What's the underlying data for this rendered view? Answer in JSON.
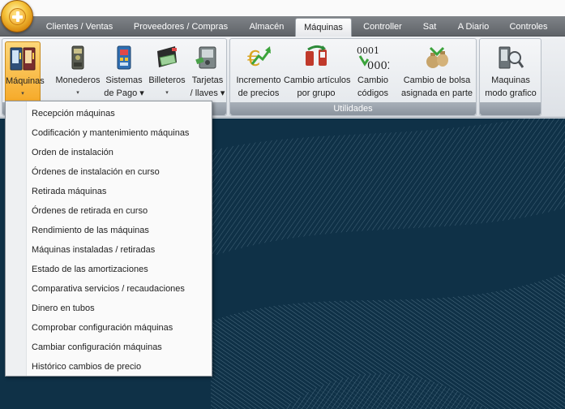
{
  "tabs": [
    {
      "label": "Clientes / Ventas"
    },
    {
      "label": "Proveedores / Compras"
    },
    {
      "label": "Almacén"
    },
    {
      "label": "Máquinas"
    },
    {
      "label": "Controller"
    },
    {
      "label": "Sat"
    },
    {
      "label": "A Diario"
    },
    {
      "label": "Controles"
    }
  ],
  "active_tab": "Máquinas",
  "ribbon": {
    "group_maquinas": {
      "buttons": [
        {
          "line1": "Máquinas",
          "line2": "▾",
          "icon": "vending-machines-icon"
        },
        {
          "line1": "Monederos",
          "line2": "▾",
          "icon": "coin-mech-icon"
        },
        {
          "line1": "Sistemas",
          "line2": "de Pago ▾",
          "icon": "payment-system-icon"
        },
        {
          "line1": "Billeteros",
          "line2": "▾",
          "icon": "bill-validator-icon"
        },
        {
          "line1": "Tarjetas",
          "line2": "/ llaves ▾",
          "icon": "cards-keys-icon"
        }
      ]
    },
    "group_utilidades": {
      "label": "Utilidades",
      "buttons": [
        {
          "line1": "Incremento",
          "line2": "de precios",
          "icon": "euro-price-increase-icon"
        },
        {
          "line1": "Cambio artículos",
          "line2": "por grupo",
          "icon": "change-items-icon"
        },
        {
          "line1": "Cambio",
          "line2": "códigos",
          "icon": "change-codes-icon",
          "code_top": "0001",
          "code_bottom": "0002"
        },
        {
          "line1": "Cambio de bolsa",
          "line2": "asignada en parte",
          "icon": "money-bag-icon"
        }
      ]
    },
    "group_grafico": {
      "buttons": [
        {
          "line1": "Maquinas",
          "line2": "modo grafico",
          "icon": "graphic-mode-icon"
        }
      ]
    }
  },
  "dropdown": {
    "items": [
      "Recepción máquinas",
      "Codificación y mantenimiento máquinas",
      "Orden de instalación",
      "Órdenes de instalación en curso",
      "Retirada máquinas",
      "Órdenes de retirada en curso",
      "Rendimiento de las máquinas",
      "Máquinas instaladas / retiradas",
      "Estado de las amortizaciones",
      "Comparativa servicios / recaudaciones",
      "Dinero en tubos",
      "Comprobar configuración máquinas",
      "Cambiar configuración máquinas",
      "Histórico cambios de precio"
    ]
  },
  "colors": {
    "tab_bar": "#6f7378",
    "pressed_button": "#f6a928",
    "background": "#0f3147",
    "menu_bg": "#fafafa"
  }
}
